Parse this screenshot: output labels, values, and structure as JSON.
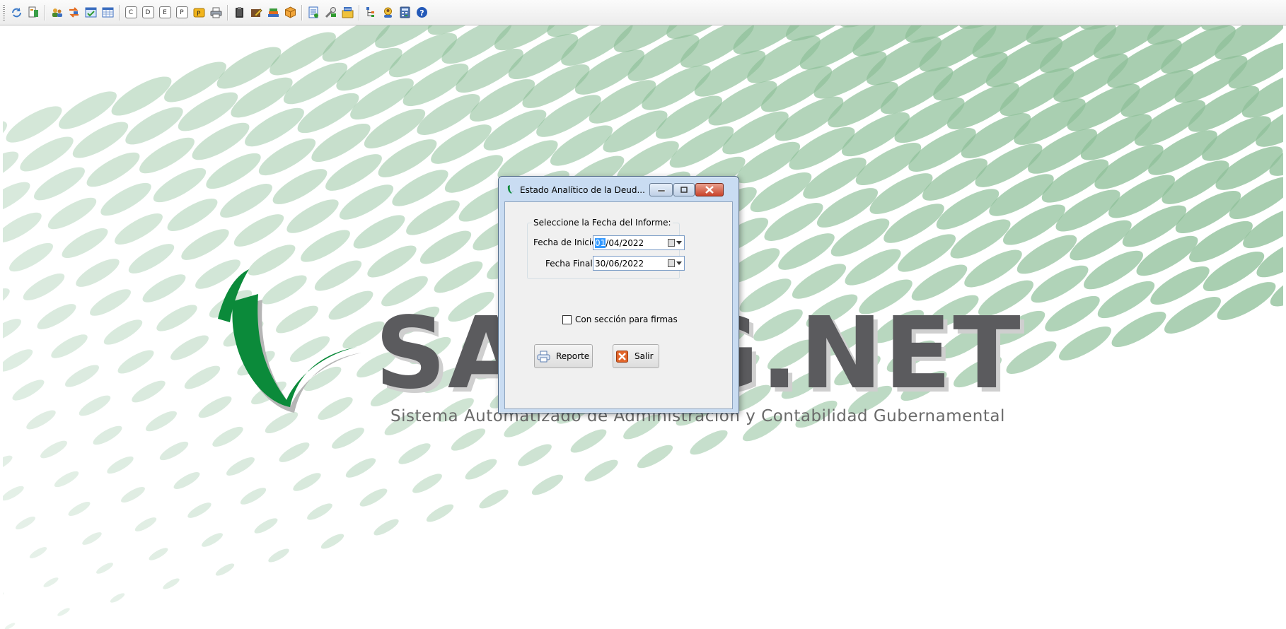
{
  "toolbar": {
    "icons": [
      "refresh-icon",
      "report-tree-icon",
      "users-icon",
      "transfer-icon",
      "approve-icon",
      "grid-icon",
      "c-letter-icon",
      "d-letter-icon",
      "e-letter-icon",
      "p-letter-icon",
      "p-folder-icon",
      "printer-icon",
      "clipboard-icon",
      "edit-icon",
      "book-stack-icon",
      "package-icon",
      "document-list-icon",
      "tools-icon",
      "config-icon",
      "hierarchy-icon",
      "user-badge-icon",
      "calculator-icon",
      "help-icon"
    ],
    "letters": {
      "c": "C",
      "d": "D",
      "e": "E",
      "p": "P"
    }
  },
  "logo": {
    "name": "SAACG.NET",
    "subtitle": "Sistema Automatizado de Administración y Contabilidad Gubernamental",
    "accent_color": "#0b8a3a",
    "text_color": "#5b5b5e"
  },
  "dialog": {
    "title": "Estado Analítico de la Deud...",
    "group_title": "Seleccione la Fecha del Informe:",
    "start_label": "Fecha de Inicio:",
    "start_value_selected": "01",
    "start_value_rest": "/04/2022",
    "end_label": "Fecha Final:",
    "end_value": "30/06/2022",
    "checkbox_label": "Con sección para firmas",
    "checkbox_checked": false,
    "report_button": "Reporte",
    "exit_button": "Salir"
  }
}
